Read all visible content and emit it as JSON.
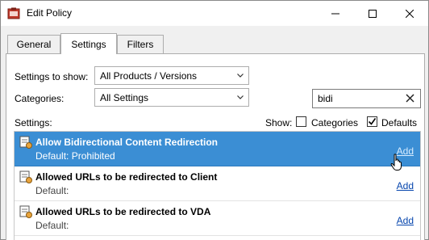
{
  "window": {
    "title": "Edit Policy"
  },
  "tabs": [
    {
      "label": "General"
    },
    {
      "label": "Settings"
    },
    {
      "label": "Filters"
    }
  ],
  "filters": {
    "settings_to_show_label": "Settings to show:",
    "settings_to_show_value": "All Products / Versions",
    "categories_label": "Categories:",
    "categories_value": "All Settings",
    "search_value": "bidi"
  },
  "list_header": {
    "settings_label": "Settings:",
    "show_label": "Show:",
    "categories_checkbox_label": "Categories",
    "categories_checked": false,
    "defaults_checkbox_label": "Defaults",
    "defaults_checked": true
  },
  "settings": [
    {
      "title": "Allow Bidirectional Content Redirection",
      "default": "Default: Prohibited",
      "action": "Add",
      "selected": true
    },
    {
      "title": "Allowed URLs to be redirected to Client",
      "default": "Default:",
      "action": "Add",
      "selected": false
    },
    {
      "title": "Allowed URLs to be redirected to VDA",
      "default": "Default:",
      "action": "Add",
      "selected": false
    }
  ],
  "colors": {
    "selection": "#3b8ed4",
    "link": "#0645ad"
  }
}
